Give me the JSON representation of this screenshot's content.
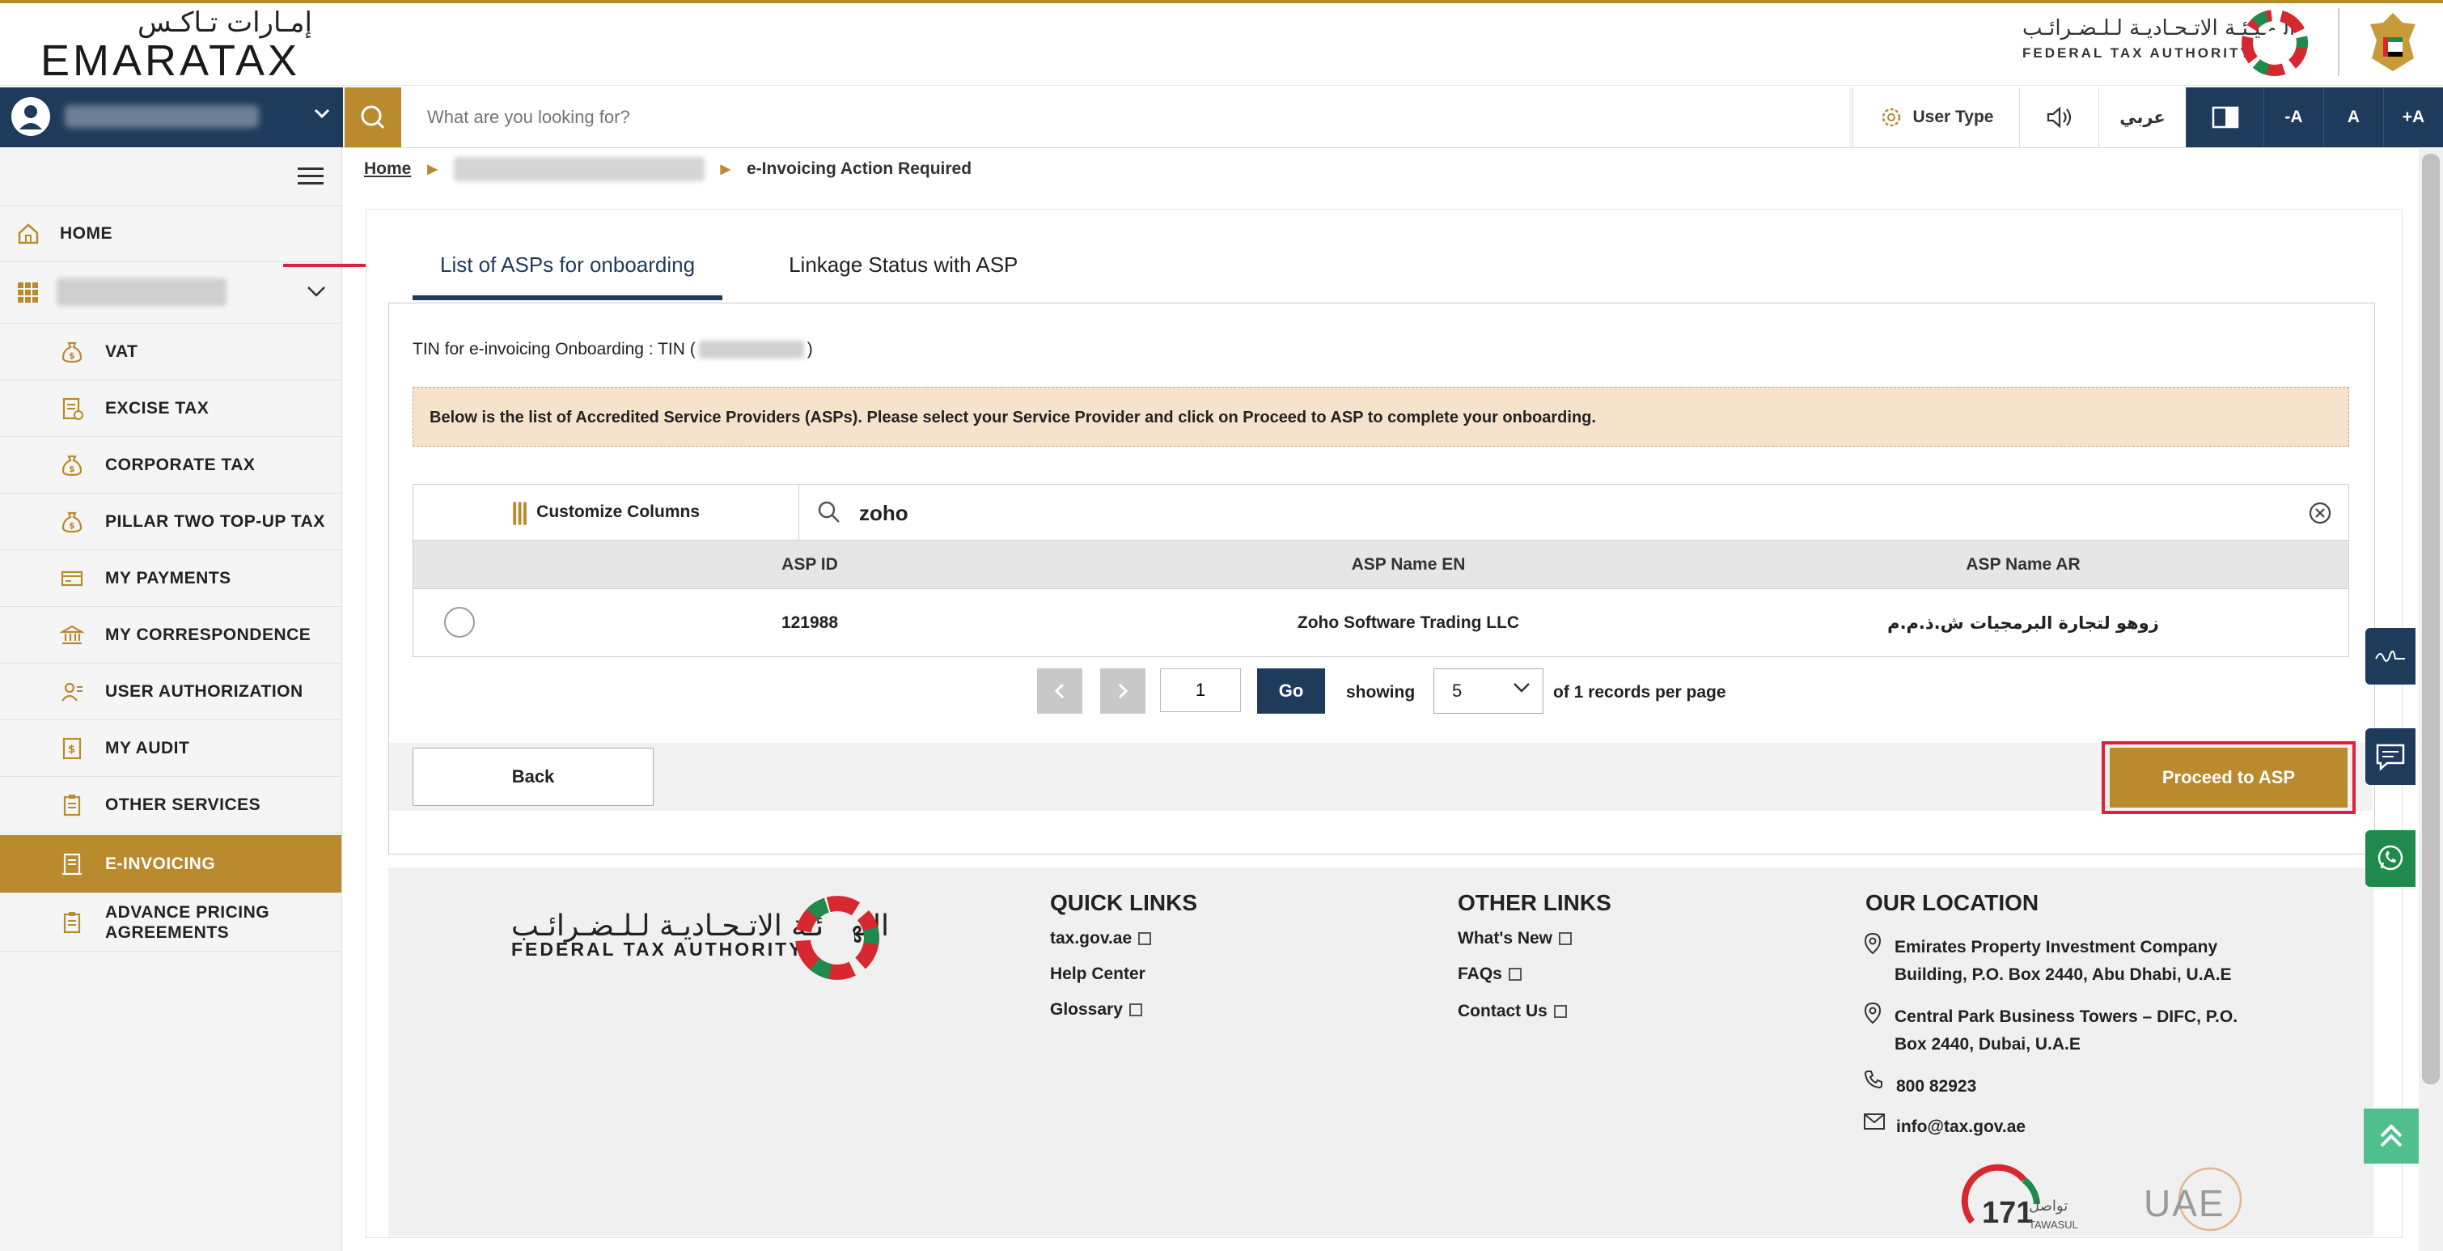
{
  "header": {
    "logo_ar": "إمـارات تـاكـس",
    "logo_en": "EMARATAX",
    "fta_ar": "الـهـيـئـة الاتـحـاديـة لـلـضـرائـب",
    "fta_en": "FEDERAL TAX AUTHORITY"
  },
  "nav": {
    "search_placeholder": "What are you looking for?",
    "user_type": "User Type",
    "arabic": "عربي",
    "font_decrease": "-A",
    "font_normal": "A",
    "font_increase": "+A"
  },
  "sidebar": {
    "items": [
      {
        "label": "HOME",
        "icon": "home-icon"
      },
      {
        "label": "VAT",
        "icon": "money-bag-icon"
      },
      {
        "label": "EXCISE TAX",
        "icon": "document-icon"
      },
      {
        "label": "CORPORATE TAX",
        "icon": "money-bag-icon"
      },
      {
        "label": "PILLAR TWO TOP-UP TAX",
        "icon": "money-bag-icon"
      },
      {
        "label": "MY PAYMENTS",
        "icon": "card-icon"
      },
      {
        "label": "MY CORRESPONDENCE",
        "icon": "bank-icon"
      },
      {
        "label": "USER AUTHORIZATION",
        "icon": "user-icon"
      },
      {
        "label": "MY AUDIT",
        "icon": "audit-icon"
      },
      {
        "label": "OTHER SERVICES",
        "icon": "clipboard-icon"
      },
      {
        "label": "E-INVOICING",
        "icon": "invoice-icon"
      },
      {
        "label": "ADVANCE PRICING AGREEMENTS",
        "icon": "clipboard-icon"
      }
    ]
  },
  "breadcrumb": {
    "home": "Home",
    "current": "e-Invoicing Action Required"
  },
  "tabs": [
    {
      "label": "List of ASPs for onboarding",
      "active": true
    },
    {
      "label": "Linkage Status with ASP",
      "active": false
    }
  ],
  "main": {
    "tin_prefix": "TIN for e-invoicing Onboarding : TIN (",
    "tin_suffix": ")",
    "notice": "Below is the list of Accredited Service Providers (ASPs). Please select your Service Provider and click on Proceed to ASP to complete your onboarding.",
    "customize_columns": "Customize Columns",
    "search_value": "zoho",
    "columns": [
      "ASP ID",
      "ASP Name EN",
      "ASP Name AR"
    ],
    "rows": [
      {
        "id": "121988",
        "name_en": "Zoho Software Trading LLC",
        "name_ar": "زوهو لتجارة البرمجيات ش.ذ.م.م"
      }
    ],
    "page_value": "1",
    "go": "Go",
    "showing": "showing",
    "per_page": "5",
    "records_text": "of 1 records per page",
    "back": "Back",
    "proceed": "Proceed to ASP"
  },
  "footer": {
    "fta_ar": "الـهـيـئـة الاتـحـاديـة لـلـضـرائـب",
    "fta_en": "FEDERAL TAX AUTHORITY",
    "quick_links_title": "QUICK LINKS",
    "quick_links": [
      "tax.gov.ae",
      "Help Center",
      "Glossary"
    ],
    "other_links_title": "OTHER LINKS",
    "other_links": [
      "What's New",
      "FAQs",
      "Contact Us"
    ],
    "location_title": "OUR LOCATION",
    "address1_line1": "Emirates Property Investment Company",
    "address1_line2": "Building, P.O. Box 2440, Abu Dhabi, U.A.E",
    "address2_line1": "Central Park Business Towers – DIFC, P.O.",
    "address2_line2": "Box 2440, Dubai, U.A.E",
    "phone": "800 82923",
    "email": "info@tax.gov.ae",
    "tawasul_ar": "تواصل",
    "tawasul_en": "TAWASUL",
    "tawasul_num": "171",
    "uae": "UAE"
  },
  "colors": {
    "gold": "#b98a2e",
    "navy": "#1f3b5c",
    "highlight_red": "#e0203c",
    "whatsapp_green": "#1f8a4c"
  }
}
